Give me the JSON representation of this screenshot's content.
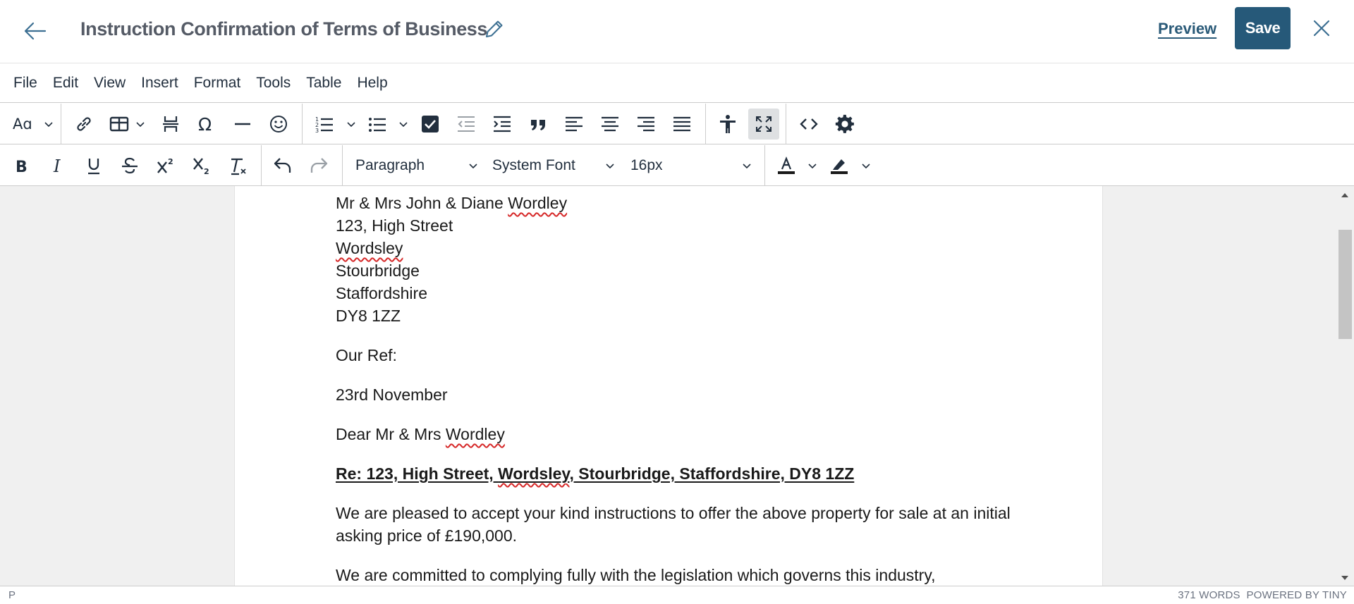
{
  "header": {
    "title": "Instruction Confirmation of Terms of Business",
    "preview_label": "Preview",
    "save_label": "Save"
  },
  "menubar": [
    "File",
    "Edit",
    "View",
    "Insert",
    "Format",
    "Tools",
    "Table",
    "Help"
  ],
  "toolbar": {
    "block_format": "Paragraph",
    "font_family": "System Font",
    "font_size": "16px"
  },
  "document": {
    "address": [
      "Mr & Mrs John & Diane ",
      "Wordley",
      "123, High Street",
      "Wordsley",
      "Stourbridge",
      "Staffordshire",
      "DY8 1ZZ"
    ],
    "our_ref": "Our Ref:",
    "date": "23rd November",
    "salutation_prefix": "Dear Mr & Mrs ",
    "salutation_name": "Wordley",
    "re_prefix": "Re: 123, High Street, ",
    "re_town": "Wordsley",
    "re_suffix": ", Stourbridge, Staffordshire, DY8 1ZZ",
    "para1": "We are pleased to accept your kind instructions to offer the above property for sale at an initial asking price of £190,000.",
    "para2": "We are committed to complying fully with the legislation which governs this industry,"
  },
  "statusbar": {
    "path": "P",
    "word_count": "371 WORDS",
    "powered_by": "POWERED BY TINY"
  },
  "colors": {
    "save_button": "#265979",
    "preview_link": "#2a5a78",
    "spellcheck_underline": "#d62828",
    "editor_background": "#f0f0f0"
  }
}
